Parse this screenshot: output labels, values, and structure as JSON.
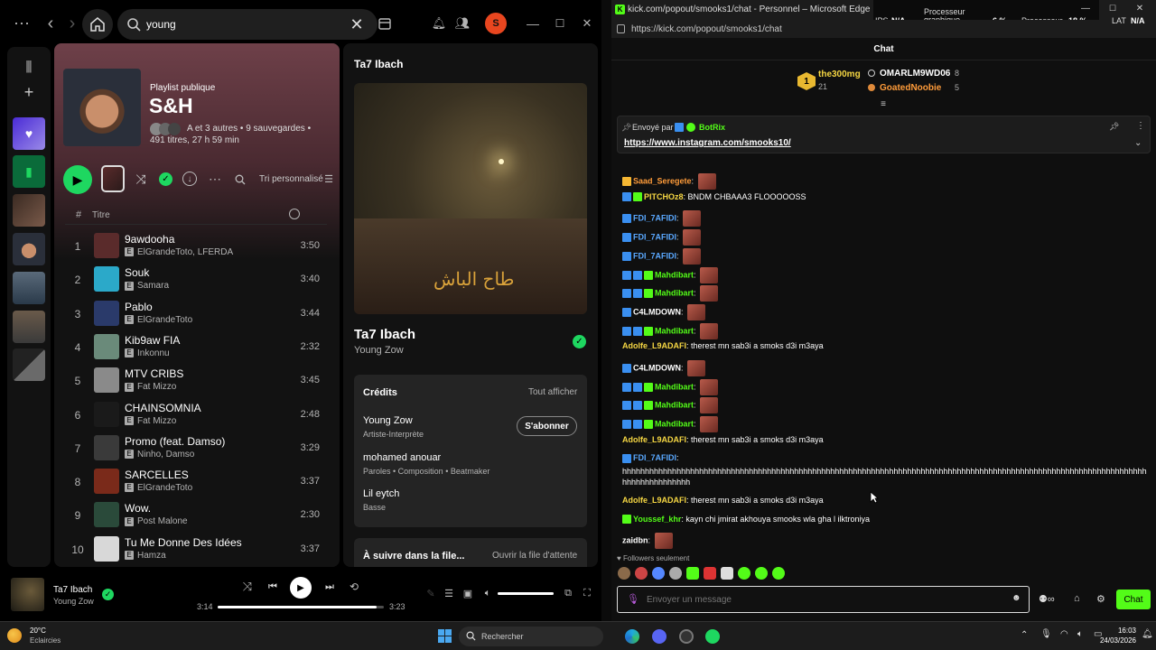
{
  "spotify": {
    "search_value": "young",
    "avatar_letter": "S",
    "playlist": {
      "type": "Playlist publique",
      "title": "S&H",
      "meta_line1": "A et 3 autres • 9 sauvegardes •",
      "meta_line2": "491 titres, 27 h 59 min",
      "sort_label": "Tri personnalisé",
      "col_num": "#",
      "col_title": "Titre"
    },
    "tracks": [
      {
        "n": "1",
        "title": "9awdooha",
        "artist": "ElGrandeToto, LFERDA",
        "dur": "3:50",
        "color": "#5a2b2b"
      },
      {
        "n": "2",
        "title": "Souk",
        "artist": "Samara",
        "dur": "3:40",
        "color": "#2ba9c9"
      },
      {
        "n": "3",
        "title": "Pablo",
        "artist": "ElGrandeToto",
        "dur": "3:44",
        "color": "#2a3a6a"
      },
      {
        "n": "4",
        "title": "Kib9aw FIA",
        "artist": "Inkonnu",
        "dur": "2:32",
        "color": "#6a8a7a"
      },
      {
        "n": "5",
        "title": "MTV CRIBS",
        "artist": "Fat Mizzo",
        "dur": "3:45",
        "color": "#8a8a8a"
      },
      {
        "n": "6",
        "title": "CHAINSOMNIA",
        "artist": "Fat Mizzo",
        "dur": "2:48",
        "color": "#1a1a1a"
      },
      {
        "n": "7",
        "title": "Promo (feat. Damso)",
        "artist": "Ninho, Damso",
        "dur": "3:29",
        "color": "#3a3a3a"
      },
      {
        "n": "8",
        "title": "SARCELLES",
        "artist": "ElGrandeToto",
        "dur": "3:37",
        "color": "#7a2a1a"
      },
      {
        "n": "9",
        "title": "Wow.",
        "artist": "Post Malone",
        "dur": "2:30",
        "color": "#2a4a3a"
      },
      {
        "n": "10",
        "title": "Tu Me Donne Des Idées",
        "artist": "Hamza",
        "dur": "3:37",
        "color": "#d8d8d8"
      }
    ],
    "now_playing": {
      "panel_title": "Ta7 Ibach",
      "art_text": "طاح الباش",
      "song": "Ta7 Ibach",
      "artist": "Young Zow",
      "credits_label": "Crédits",
      "show_all": "Tout afficher",
      "credits": [
        {
          "name": "Young Zow",
          "role": "Artiste-Interprète"
        },
        {
          "name": "mohamed anouar",
          "role": "Paroles • Composition • Beatmaker"
        },
        {
          "name": "Lil eytch",
          "role": "Basse"
        }
      ],
      "follow_label": "S'abonner",
      "queue_label": "À suivre dans la file...",
      "open_queue": "Ouvrir la file d'attente"
    },
    "player": {
      "title": "Ta7 Ibach",
      "artist": "Young Zow",
      "elapsed": "3:14",
      "total": "3:23",
      "progress": 0.955,
      "volume": 1.0
    }
  },
  "edge": {
    "window_title": "kick.com/popout/smooks1/chat - Personnel – Microsoft Edge",
    "url": "https://kick.com/popout/smooks1/chat",
    "overlay": {
      "ips_label": "IPS",
      "ips_value": "N/A",
      "gpu_label": "Processeur graphique",
      "gpu_value": "6 %",
      "cpu_label": "Processeur",
      "cpu_value": "18 %",
      "lat_label": "LAT",
      "lat_value": "N/A"
    },
    "chat_title": "Chat",
    "leaderboard": [
      {
        "rank": "1",
        "name": "the300mg",
        "count": "21"
      },
      {
        "name": "OMARLM9WD06",
        "count": "8"
      },
      {
        "name": "GoatedNoobie",
        "count": "5"
      }
    ],
    "pinned": {
      "sent_by": "Envoyé par",
      "author": "BotRix",
      "link": "https://www.instagram.com/smooks10/"
    },
    "messages": [
      {
        "user": "Saad_Seregete",
        "cls": "u-orange",
        "text": "",
        "emote": true,
        "badges": [
          "y"
        ]
      },
      {
        "user": "PITCHOz8",
        "cls": "u-yellow",
        "text": "BNDM CHBAAA3 FLOOOOOSS",
        "emote": false,
        "badges": [
          "b",
          "g"
        ]
      },
      {
        "user": "FDI_7AFIDI",
        "cls": "u-blue",
        "text": "",
        "emote": true,
        "badges": [
          "b"
        ]
      },
      {
        "user": "FDI_7AFIDI",
        "cls": "u-blue",
        "text": "",
        "emote": true,
        "badges": [
          "b"
        ]
      },
      {
        "user": "FDI_7AFIDI",
        "cls": "u-blue",
        "text": "",
        "emote": true,
        "badges": [
          "b"
        ]
      },
      {
        "user": "Mahdibart",
        "cls": "u-green",
        "text": "",
        "emote": true,
        "badges": [
          "b",
          "b",
          "g"
        ]
      },
      {
        "user": "Mahdibart",
        "cls": "u-green",
        "text": "",
        "emote": true,
        "badges": [
          "b",
          "b",
          "g"
        ]
      },
      {
        "user": "C4LMDOWN",
        "cls": "u-white",
        "text": "",
        "emote": true,
        "badges": [
          "b"
        ]
      },
      {
        "user": "Mahdibart",
        "cls": "u-green",
        "text": "",
        "emote": true,
        "badges": [
          "b",
          "b",
          "g"
        ]
      },
      {
        "user": "Adolfe_L9ADAFI",
        "cls": "u-yellow",
        "text": "therest mn sab3i a smoks d3i m3aya",
        "emote": false,
        "badges": []
      },
      {
        "user": "C4LMDOWN",
        "cls": "u-white",
        "text": "",
        "emote": true,
        "badges": [
          "b"
        ]
      },
      {
        "user": "Mahdibart",
        "cls": "u-green",
        "text": "",
        "emote": true,
        "badges": [
          "b",
          "b",
          "g"
        ]
      },
      {
        "user": "Mahdibart",
        "cls": "u-green",
        "text": "",
        "emote": true,
        "badges": [
          "b",
          "b",
          "g"
        ]
      },
      {
        "user": "Mahdibart",
        "cls": "u-green",
        "text": "",
        "emote": true,
        "badges": [
          "b",
          "b",
          "g"
        ]
      },
      {
        "user": "Adolfe_L9ADAFI",
        "cls": "u-yellow",
        "text": "therest mn sab3i a smoks d3i m3aya",
        "emote": false,
        "badges": []
      }
    ],
    "long_msg_user": "FDI_7AFIDI",
    "long_msg_text1": "hhhhhhhhhhhhhhhhhhhhhhhhhhhhhhhhhhhhhhhhhhhhhhhhhhhhhhhhhhhhhhhhhhhhhhhhhhhhhhhhhhhhhhhhhhhhhhhhhhhhhhhhhhhhhhhhhhhh",
    "long_msg_text2": "hhhhhhhhhhhhhhh",
    "messages2": [
      {
        "user": "Adolfe_L9ADAFI",
        "cls": "u-yellow",
        "text": "therest mn sab3i a smoks d3i m3aya",
        "emote": false,
        "badges": []
      },
      {
        "user": "Youssef_khr",
        "cls": "u-green",
        "text": "kayn chi jmirat akhouya smooks wla gha l ilktroniya",
        "emote": false,
        "badges": [
          "g"
        ]
      },
      {
        "user": "zaidbn",
        "cls": "u-white",
        "text": "",
        "emote": true,
        "badges": []
      }
    ],
    "followers_only": "Followers seulement",
    "input_placeholder": "Envoyer un message",
    "send_label": "Chat"
  },
  "taskbar": {
    "temp": "20°C",
    "weather": "Eclaircies",
    "search_placeholder": "Rechercher",
    "time": "16:03",
    "date": "24/03/2026"
  },
  "colors": {
    "spotify_green": "#1ed760",
    "kick_green": "#53fc18"
  }
}
